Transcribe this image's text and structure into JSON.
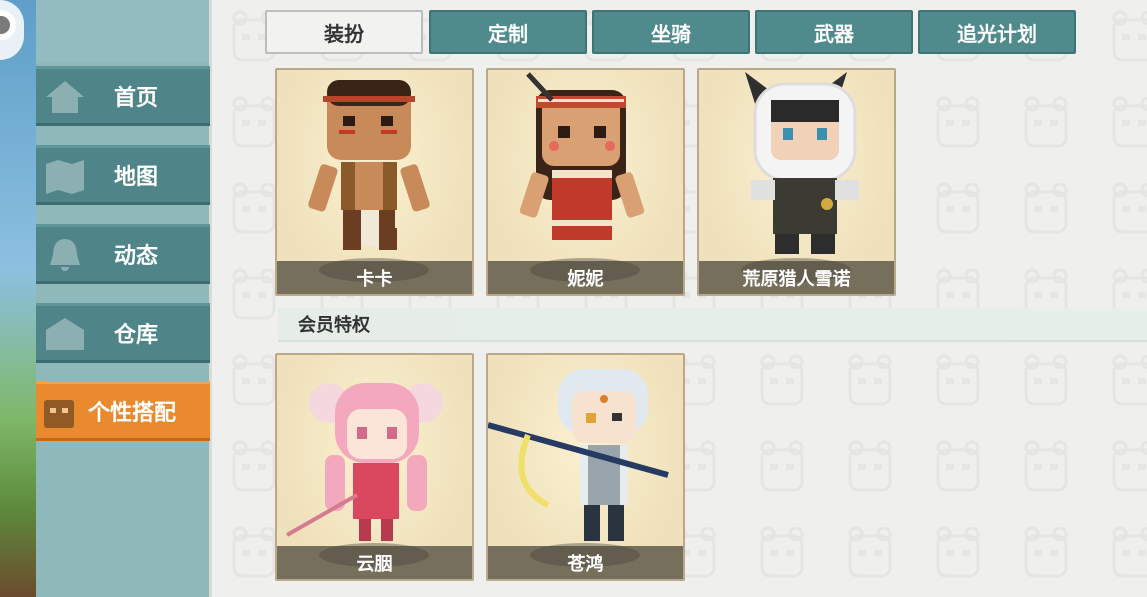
{
  "sidebar": {
    "items": [
      {
        "label": "首页",
        "icon": "home-icon"
      },
      {
        "label": "地图",
        "icon": "map-icon"
      },
      {
        "label": "动态",
        "icon": "bell-icon"
      },
      {
        "label": "仓库",
        "icon": "warehouse-icon"
      },
      {
        "label": "个性搭配",
        "icon": "outfit-icon",
        "active": true
      }
    ]
  },
  "tabs": [
    {
      "label": "装扮",
      "active": true
    },
    {
      "label": "定制"
    },
    {
      "label": "坐骑"
    },
    {
      "label": "武器"
    },
    {
      "label": "追光计划"
    }
  ],
  "skins": [
    {
      "name": "卡卡"
    },
    {
      "name": "妮妮"
    },
    {
      "name": "荒原猎人雪诺"
    }
  ],
  "vip_section": {
    "title": "会员特权",
    "skins": [
      {
        "name": "云胭"
      },
      {
        "name": "苍鸿"
      }
    ]
  },
  "colors": {
    "sidebar_item": "#4f8589",
    "sidebar_active": "#e98a2f",
    "tab": "#4f8b8c",
    "card_bg": "#efe1bb"
  }
}
